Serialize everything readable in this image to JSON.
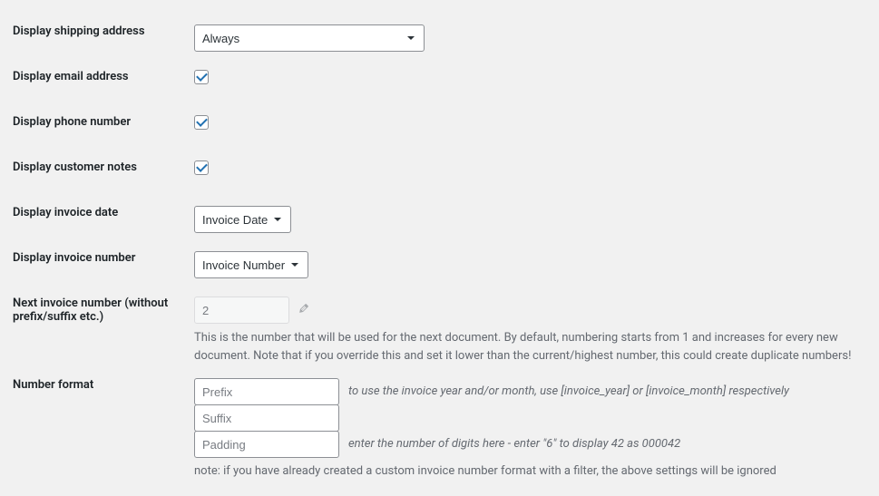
{
  "fields": {
    "shipping_address": {
      "label": "Display shipping address",
      "value": "Always"
    },
    "email_address": {
      "label": "Display email address",
      "checked": true
    },
    "phone_number": {
      "label": "Display phone number",
      "checked": true
    },
    "customer_notes": {
      "label": "Display customer notes",
      "checked": true
    },
    "invoice_date": {
      "label": "Display invoice date",
      "value": "Invoice Date"
    },
    "invoice_number": {
      "label": "Display invoice number",
      "value": "Invoice Number"
    },
    "next_invoice": {
      "label": "Next invoice number (without prefix/suffix etc.)",
      "value": "2",
      "description": "This is the number that will be used for the next document. By default, numbering starts from 1 and increases for every new document. Note that if you override this and set it lower than the current/highest number, this could create duplicate numbers!"
    },
    "number_format": {
      "label": "Number format",
      "prefix_placeholder": "Prefix",
      "suffix_placeholder": "Suffix",
      "padding_placeholder": "Padding",
      "prefix_hint": "to use the invoice year and/or month, use [invoice_year] or [invoice_month] respectively",
      "padding_hint": "enter the number of digits here - enter \"6\" to display 42 as 000042",
      "note": "note: if you have already created a custom invoice number format with a filter, the above settings will be ignored"
    }
  }
}
